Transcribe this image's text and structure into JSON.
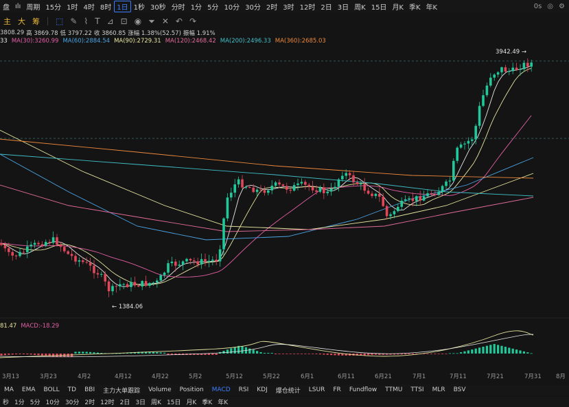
{
  "topbar": {
    "items": [
      "盘",
      "ılı",
      "周期",
      "15分",
      "1时",
      "4时",
      "8时",
      "1日",
      "1秒",
      "30秒",
      "分时",
      "1分",
      "5分",
      "10分",
      "30分",
      "2时",
      "3时",
      "12时",
      "2日",
      "3日",
      "周K",
      "15日",
      "月K",
      "季K",
      "年K"
    ],
    "selected_index": 7,
    "right": [
      "0s",
      "camera-icon",
      "settings-icon"
    ]
  },
  "toolbar2": {
    "chip_labels": [
      "主",
      "大",
      "筹"
    ],
    "icons": [
      "select-icon",
      "pen-icon",
      "brush-icon",
      "text-icon",
      "ruler-icon",
      "lock-icon",
      "eye-icon",
      "filter-icon",
      "delete-icon",
      "undo-icon",
      "redo-icon"
    ]
  },
  "ohlc": {
    "items": [
      "3808.29",
      "高 3869.78",
      "低 3797.22",
      "收 3860.85",
      "涨幅 1.38%(52.57)",
      "振幅 1.91%"
    ]
  },
  "ma_legend": [
    {
      "label": "33",
      "color": "#e8e8e8"
    },
    {
      "label": "MA(30):3260.99",
      "color": "#e35ea6"
    },
    {
      "label": "MA(60):2884.54",
      "color": "#4aa5e6"
    },
    {
      "label": "MA(90):2729.31",
      "color": "#e8e6a0"
    },
    {
      "label": "MA(120):2468.42",
      "color": "#e36b9a"
    },
    {
      "label": "MA(200):2496.33",
      "color": "#3fc0c8"
    },
    {
      "label": "MA(360):2685.03",
      "color": "#f08a3c"
    }
  ],
  "price_labels": {
    "high": "3942.49",
    "low": "1384.06"
  },
  "macd_legend": [
    {
      "label": "81.47",
      "color": "#e8e6a0"
    },
    {
      "label": "MACD:-18.29",
      "color": "#e35ea6"
    }
  ],
  "dates": [
    "3月13",
    "3月23",
    "4月2",
    "4月12",
    "4月22",
    "5月2",
    "5月12",
    "5月22",
    "6月1",
    "6月11",
    "6月21",
    "7月1",
    "7月11",
    "7月21",
    "7月31",
    "8月"
  ],
  "indicator_tabs": [
    "MA",
    "EMA",
    "BOLL",
    "TD",
    "BBI",
    "主力大单跟踪",
    "Volume",
    "Position",
    "MACD",
    "RSI",
    "KDJ",
    "爆仓统计",
    "LSUR",
    "FR",
    "Fundflow",
    "TTMU",
    "TTSI",
    "MLR",
    "BSV"
  ],
  "indicator_selected": "MACD",
  "bottom_tabs": [
    "秒",
    "1分",
    "5分",
    "10分",
    "30分",
    "2时",
    "12时",
    "2日",
    "3日",
    "周K",
    "15日",
    "月K",
    "季K",
    "年K"
  ],
  "colors": {
    "up": "#22c79a",
    "down": "#e0485a",
    "accent": "#3d7dff"
  }
}
